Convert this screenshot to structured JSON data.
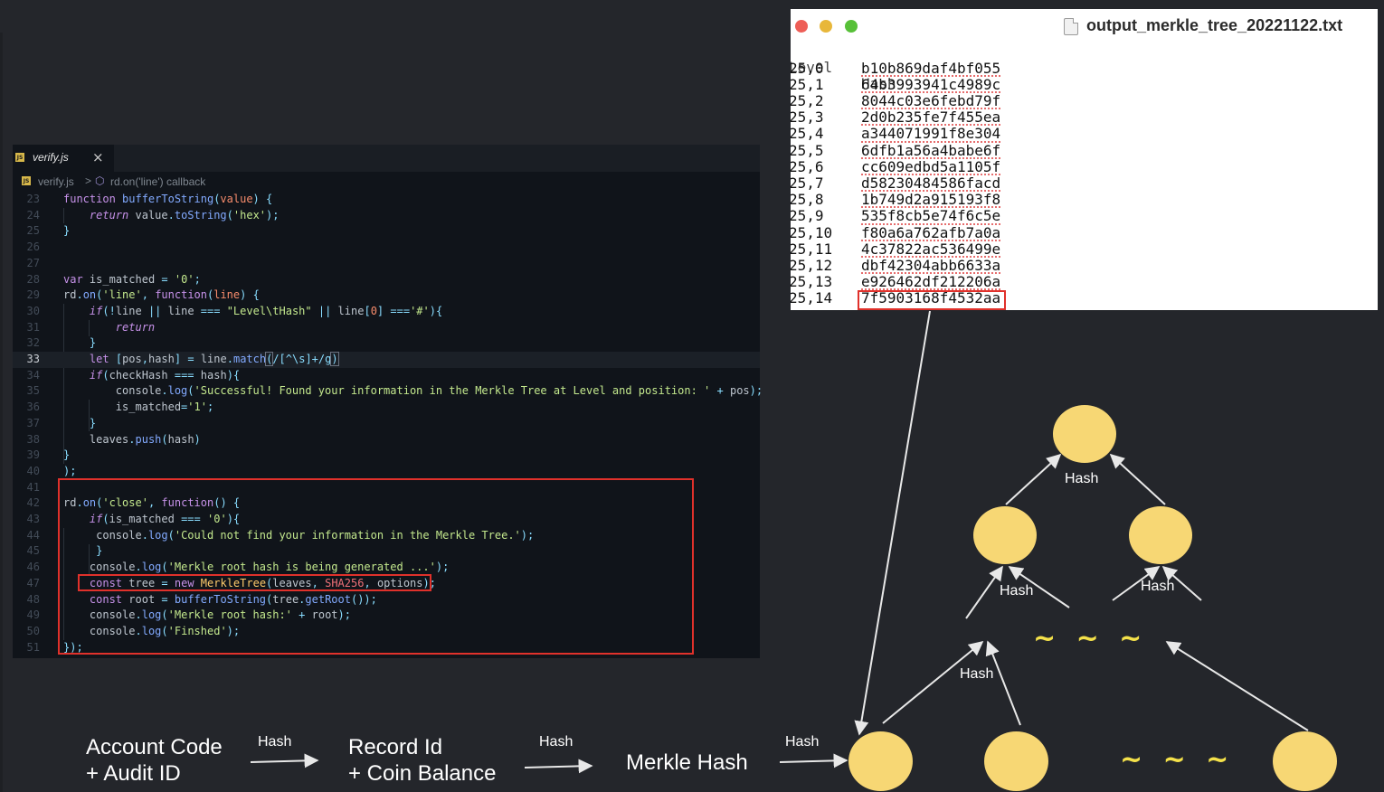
{
  "editor": {
    "tab_label": "verify.js",
    "tab_close_icon": "×",
    "breadcrumb_file": "verify.js",
    "breadcrumb_separator": ">",
    "breadcrumb_symbol": "rd.on('line') callback",
    "line_numbers": [
      "23",
      "24",
      "25",
      "26",
      "27",
      "28",
      "29",
      "30",
      "31",
      "32",
      "33",
      "34",
      "35",
      "36",
      "37",
      "38",
      "39",
      "40",
      "41",
      "42",
      "43",
      "44",
      "45",
      "46",
      "47",
      "48",
      "49",
      "50",
      "51"
    ],
    "current_line": "33",
    "strings": {
      "hex": "'hex'",
      "zero": "'0'",
      "line": "'line'",
      "level_hash": "\"Level\\tHash\"",
      "hash_char": "'#'",
      "success": "'Successful! Found your information in the Merkle Tree at Level and position: '",
      "one": "'1'",
      "close": "'close'",
      "not_found": "'Could not find your information in the Merkle Tree.'",
      "generating": "'Merkle root hash is being generated ...'",
      "root_hash": "'Merkle root hash:'",
      "finished": "'Finshed'"
    },
    "regex": "/[^\\s]+/g"
  },
  "text_window": {
    "title": "output_merkle_tree_20221122.txt",
    "header": [
      "Level",
      "Hash"
    ],
    "rows": [
      {
        "pos": "25,0",
        "hash": "b10b869daf4bf055"
      },
      {
        "pos": "25,1",
        "hash": "64b3993941c4989c"
      },
      {
        "pos": "25,2",
        "hash": "8044c03e6febd79f"
      },
      {
        "pos": "25,3",
        "hash": "2d0b235fe7f455ea"
      },
      {
        "pos": "25,4",
        "hash": "a344071991f8e304"
      },
      {
        "pos": "25,5",
        "hash": "6dfb1a56a4babe6f"
      },
      {
        "pos": "25,6",
        "hash": "cc609edbd5a1105f"
      },
      {
        "pos": "25,7",
        "hash": "d58230484586facd"
      },
      {
        "pos": "25,8",
        "hash": "1b749d2a915193f8"
      },
      {
        "pos": "25,9",
        "hash": "535f8cb5e74f6c5e"
      },
      {
        "pos": "25,10",
        "hash": "f80a6a762afb7a0a"
      },
      {
        "pos": "25,11",
        "hash": "4c37822ac536499e"
      },
      {
        "pos": "25,12",
        "hash": "dbf42304abb6633a"
      },
      {
        "pos": "25,13",
        "hash": "e926462df212206a"
      },
      {
        "pos": "25,14",
        "hash": "7f5903168f4532aa"
      }
    ],
    "highlighted_row": "25,14"
  },
  "diagram": {
    "hash_label": "Hash",
    "ellipsis": "~ ~ ~",
    "flow": {
      "step1_line1": "Account Code",
      "step1_line2": "+ Audit ID",
      "step2_line1": "Record Id",
      "step2_line2": "+ Coin Balance",
      "step3": "Merkle Hash"
    }
  },
  "colors": {
    "background": "#24262b",
    "editor_bg": "#10141a",
    "highlight_red": "#e0312b",
    "node_yellow": "#f7d774",
    "tilde_yellow": "#f4e14a"
  }
}
